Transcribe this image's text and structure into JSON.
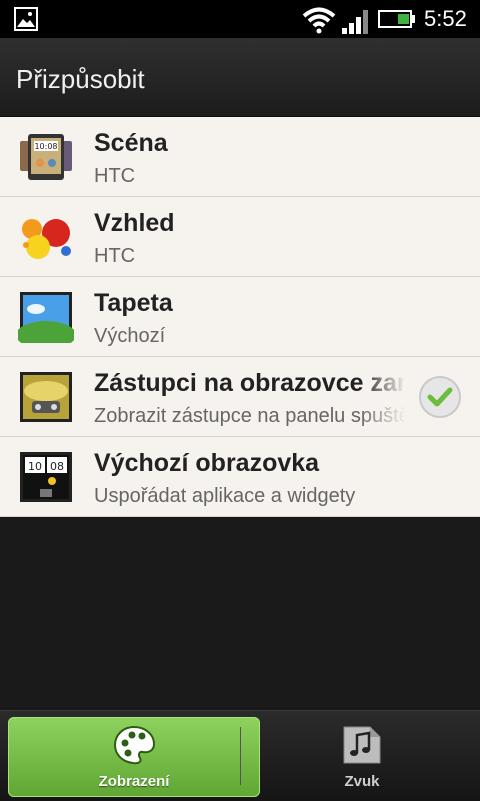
{
  "status_bar": {
    "time": "5:52",
    "icons": [
      "gallery-icon",
      "wifi-icon",
      "signal-icon",
      "battery-icon"
    ],
    "battery_color": "#3fb33f"
  },
  "header": {
    "title": "Přizpůsobit"
  },
  "list": {
    "items": [
      {
        "title": "Scéna",
        "subtitle": "HTC",
        "icon": "scene-icon"
      },
      {
        "title": "Vzhled",
        "subtitle": "HTC",
        "icon": "skin-icon"
      },
      {
        "title": "Tapeta",
        "subtitle": "Výchozí",
        "icon": "wallpaper-icon"
      },
      {
        "title": "Zástupci na obrazovce zamčení",
        "subtitle": "Zobrazit zástupce na panelu spuštění",
        "icon": "lockscreen-icon",
        "checked": true
      },
      {
        "title": "Výchozí obrazovka",
        "subtitle": "Uspořádat aplikace a widgety",
        "icon": "home-screen-icon"
      }
    ]
  },
  "tabs": [
    {
      "label": "Zobrazení",
      "icon": "palette-icon",
      "active": true
    },
    {
      "label": "Zvuk",
      "icon": "music-note-icon",
      "active": false
    }
  ],
  "colors": {
    "accent": "#6cbd3c",
    "list_background": "#f6f2ee",
    "app_background": "#1a1a1a"
  }
}
